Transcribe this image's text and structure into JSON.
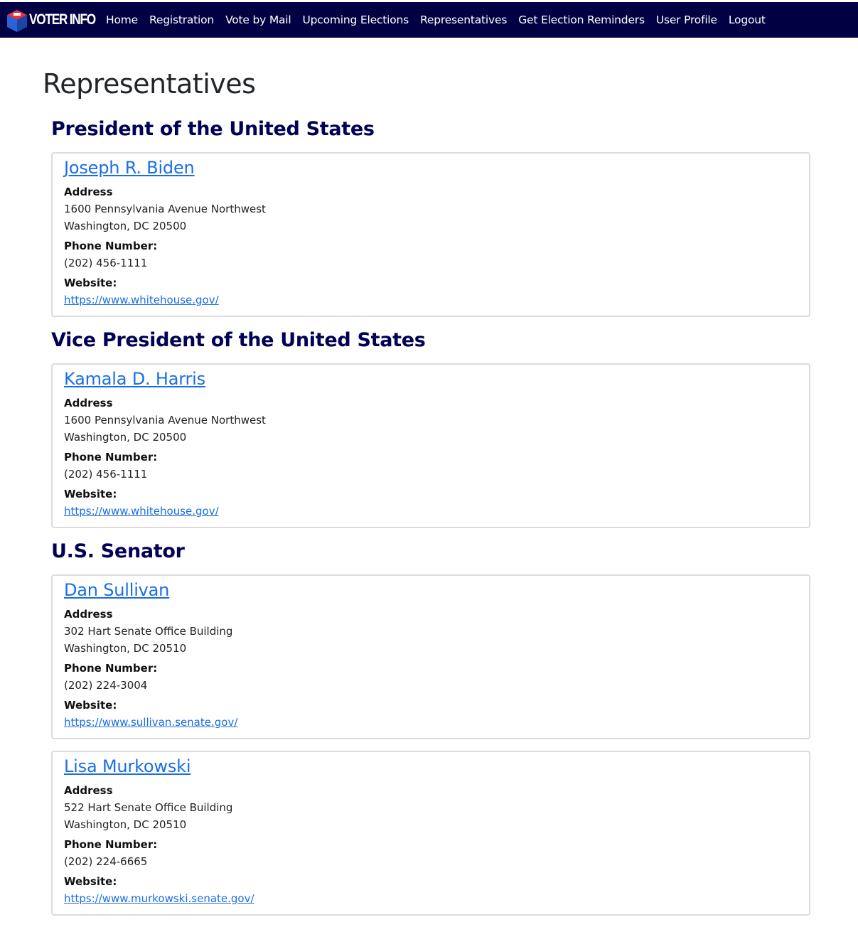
{
  "nav": {
    "brand": "VOTER INFO",
    "links": [
      "Home",
      "Registration",
      "Vote by Mail",
      "Upcoming Elections",
      "Representatives",
      "Get Election Reminders",
      "User Profile",
      "Logout"
    ]
  },
  "page": {
    "title": "Representatives"
  },
  "labels": {
    "address": "Address",
    "phone": "Phone Number:",
    "website": "Website:"
  },
  "sections": [
    {
      "title": "President of the United States"
    },
    {
      "title": "Vice President of the United States"
    },
    {
      "title": "U.S. Senator"
    }
  ],
  "reps": [
    {
      "name": "Joseph R. Biden",
      "address_line1": "1600 Pennsylvania Avenue Northwest",
      "address_line2": "Washington, DC 20500",
      "phone": "(202) 456-1111",
      "website": "https://www.whitehouse.gov/"
    },
    {
      "name": "Kamala D. Harris",
      "address_line1": "1600 Pennsylvania Avenue Northwest",
      "address_line2": "Washington, DC 20500",
      "phone": "(202) 456-1111",
      "website": "https://www.whitehouse.gov/"
    },
    {
      "name": "Dan Sullivan",
      "address_line1": "302 Hart Senate Office Building",
      "address_line2": "Washington, DC 20510",
      "phone": "(202) 224-3004",
      "website": "https://www.sullivan.senate.gov/"
    },
    {
      "name": "Lisa Murkowski",
      "address_line1": "522 Hart Senate Office Building",
      "address_line2": "Washington, DC 20510",
      "phone": "(202) 224-6665",
      "website": "https://www.murkowski.senate.gov/"
    }
  ],
  "colors": {
    "navbar": "#000043",
    "heading": "#000055",
    "link": "#1a6ee6"
  }
}
